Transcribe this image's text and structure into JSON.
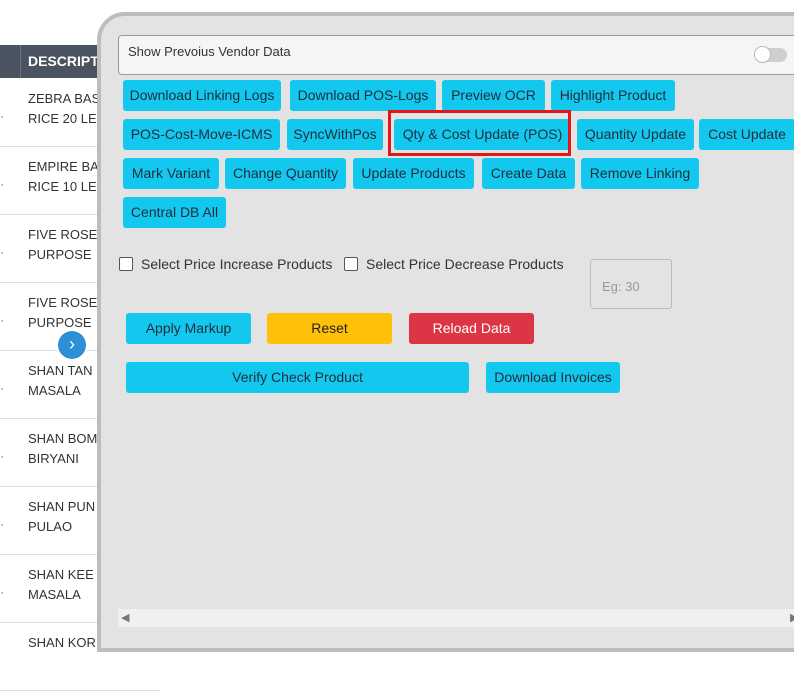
{
  "table": {
    "header": "DESCRIPT",
    "rows": [
      {
        "line1": "ZEBRA BAS",
        "line2": "RICE 20 LE"
      },
      {
        "line1": "EMPIRE BA",
        "line2": "RICE 10 LE"
      },
      {
        "line1": "FIVE ROSE",
        "line2": "PURPOSE"
      },
      {
        "line1": "FIVE ROSE",
        "line2": "PURPOSE"
      },
      {
        "line1": "SHAN TAN",
        "line2": "MASALA"
      },
      {
        "line1": "SHAN BOM",
        "line2": "BIRYANI"
      },
      {
        "line1": "SHAN PUN",
        "line2": "PULAO"
      },
      {
        "line1": "SHAN KEE",
        "line2": "MASALA"
      },
      {
        "line1": "SHAN KORI",
        "line2": ""
      }
    ],
    "row_marker": "·"
  },
  "expand_icon": "chevron-right",
  "panel": {
    "vendor_toggle_label": "Show Prevoius Vendor Data",
    "vendor_toggle_on": false,
    "buttons_row1": [
      "Download Linking Logs",
      "Download POS-Logs",
      "Preview OCR",
      "Highlight Product"
    ],
    "buttons_row2": [
      "POS-Cost-Move-ICMS",
      "SyncWithPos",
      "Qty & Cost Update (POS)",
      "Quantity Update",
      "Cost Update"
    ],
    "buttons_row3": [
      "Mark Variant",
      "Change Quantity",
      "Update Products",
      "Create Data",
      "Remove Linking"
    ],
    "buttons_row4": [
      "Central DB All"
    ],
    "highlighted_button": "Qty & Cost Update (POS)",
    "check_increase": "Select Price Increase Products",
    "check_decrease": "Select Price Decrease Products",
    "markup_placeholder": "Eg: 30",
    "apply_markup": "Apply Markup",
    "reset": "Reset",
    "reload_data": "Reload Data",
    "verify_check_product": "Verify Check Product",
    "download_invoices": "Download Invoices"
  },
  "colors": {
    "primary": "#12c8ef",
    "warning": "#ffc107",
    "danger": "#dc3545",
    "highlight": "#e0161b",
    "header_bg": "#4a5360"
  }
}
